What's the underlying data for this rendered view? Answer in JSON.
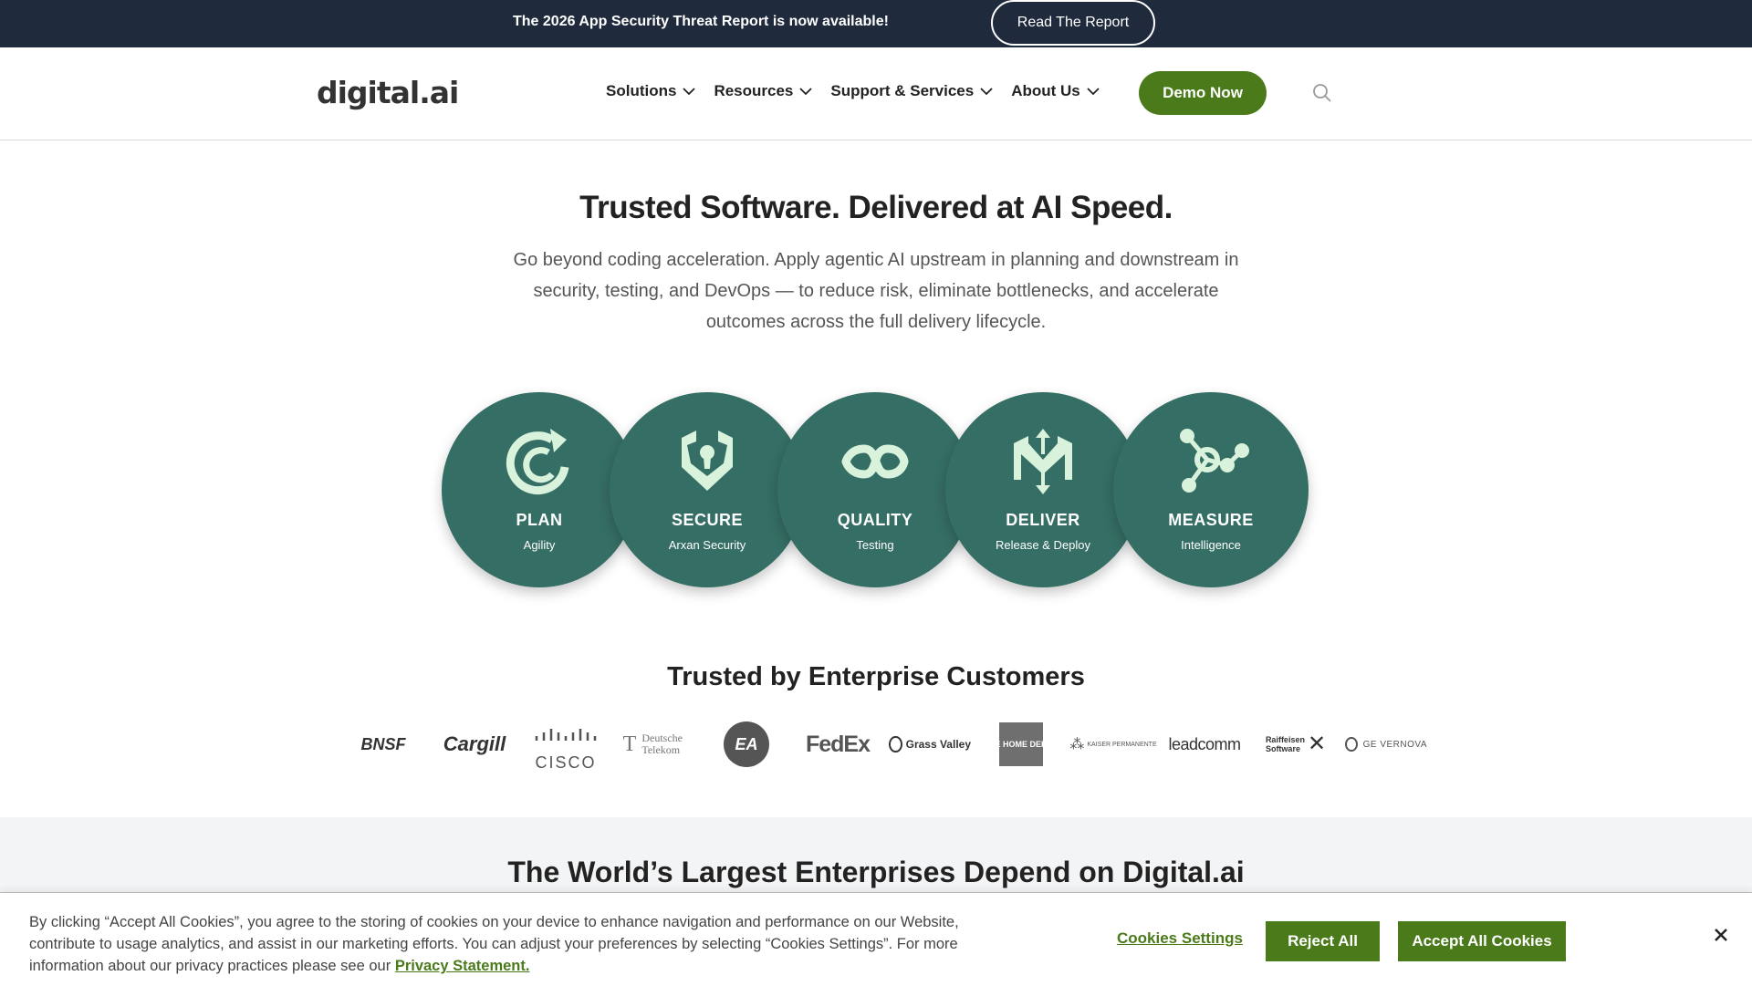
{
  "promo": {
    "text": "The 2026 App Security Threat Report is now available!",
    "button": "Read The Report"
  },
  "header": {
    "logo": "digital.ai",
    "nav": [
      "Solutions",
      "Resources",
      "Support & Services",
      "About Us"
    ],
    "demo_button": "Demo Now",
    "search_icon": "search-icon"
  },
  "hero": {
    "title": "Trusted Software. Delivered at AI Speed.",
    "subtitle": "Go beyond coding acceleration. Apply agentic AI upstream in planning and downstream in security, testing, and DevOps — to reduce risk, eliminate bottlenecks, and accelerate outcomes across the full delivery lifecycle."
  },
  "pillars": [
    {
      "title": "PLAN",
      "subtitle": "Agility",
      "icon": "refresh-c-icon"
    },
    {
      "title": "SECURE",
      "subtitle": "Arxan Security",
      "icon": "shield-keyhole-icon"
    },
    {
      "title": "QUALITY",
      "subtitle": "Testing",
      "icon": "infinity-icon"
    },
    {
      "title": "DELIVER",
      "subtitle": "Release & Deploy",
      "icon": "cube-arrows-icon"
    },
    {
      "title": "MEASURE",
      "subtitle": "Intelligence",
      "icon": "network-nodes-icon"
    }
  ],
  "customers": {
    "title": "Trusted by Enterprise Customers",
    "logos": [
      "BNSF",
      "Cargill",
      "CISCO",
      "Deutsche Telekom",
      "EA",
      "FedEx",
      "Grass Valley",
      "THE HOME DEPOT",
      "KAISER PERMANENTE",
      "leadcomm",
      "Raiffeisen Software",
      "GE VERNOVA"
    ]
  },
  "band": {
    "title": "The World’s Largest Enterprises Depend on Digital.ai"
  },
  "cookie": {
    "text": "By clicking “Accept All Cookies”, you agree to the storing of cookies on your device to enhance navigation and performance on our Website, contribute to usage analytics, and assist in our marketing efforts. You can adjust your preferences by selecting “Cookies Settings”. For more information about our privacy practices please see our",
    "privacy_link": "Privacy Statement.",
    "settings": "Cookies Settings",
    "reject": "Reject All",
    "accept": "Accept All Cookies"
  },
  "colors": {
    "promo_bg": "#1f2a3c",
    "brand_green": "#4a7a1a",
    "pillar_teal": "#356e64",
    "icon_mint": "#d9f2dc"
  }
}
